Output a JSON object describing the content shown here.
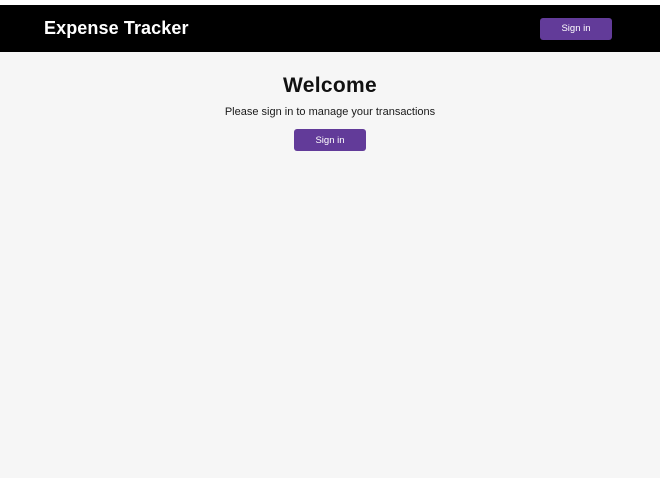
{
  "header": {
    "app_title": "Expense Tracker",
    "signin_label": "Sign in"
  },
  "main": {
    "title": "Welcome",
    "subtitle": "Please sign in to manage your transactions",
    "signin_label": "Sign in"
  },
  "colors": {
    "navbar_bg": "#000000",
    "accent": "#623b99",
    "page_bg": "#f6f6f6"
  }
}
